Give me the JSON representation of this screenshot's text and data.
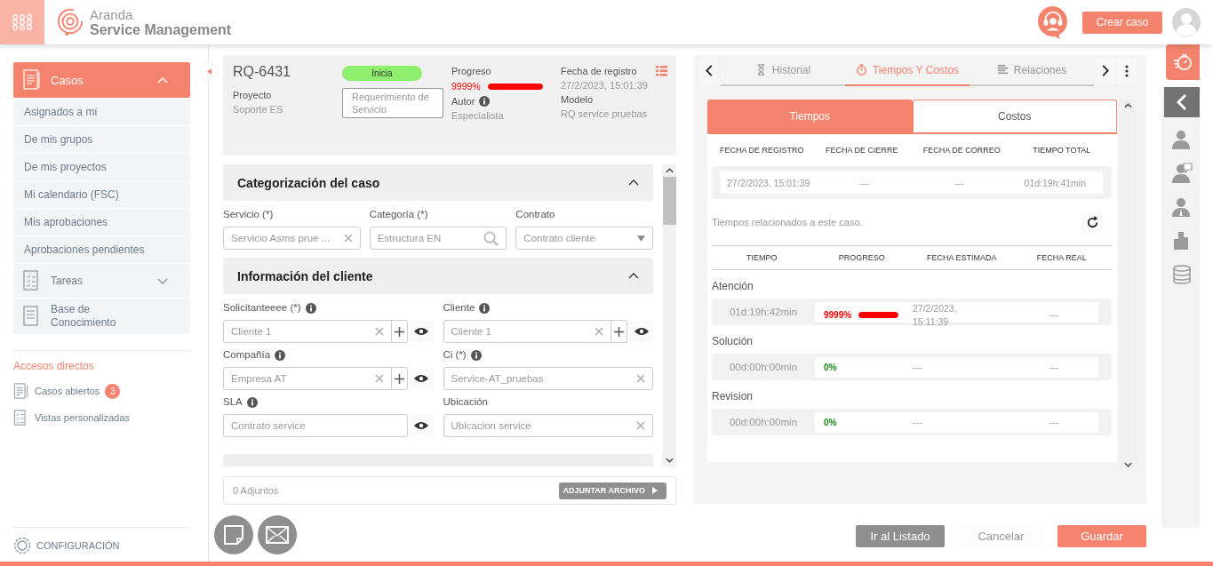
{
  "header": {
    "brand_top": "Aranda",
    "brand_bottom": "Service Management",
    "create_button": "Crear caso"
  },
  "sidebar": {
    "menu": [
      {
        "label": "Casos",
        "kind": "cases",
        "selected": true,
        "expanded": true,
        "children": [
          {
            "label": "Asignados a mi",
            "selected": false
          },
          {
            "label": "De mis grupos",
            "selected": false
          },
          {
            "label": "De mis proyectos",
            "selected": false
          },
          {
            "label": "Mi calendario (FSC)",
            "selected": false
          },
          {
            "label": "Mis aprobaciones",
            "selected": false
          },
          {
            "label": "Aprobaciones pendientes",
            "selected": false
          }
        ]
      },
      {
        "label": "Tareas",
        "kind": "tasks",
        "selected": false,
        "expanded": false
      },
      {
        "label": "Base de Conocimiento",
        "kind": "knowledge",
        "selected": false
      }
    ],
    "shortcuts_title": "Accesos directos",
    "shortcuts": [
      {
        "label": "Casos abiertos",
        "kind": "cases",
        "badge": "3"
      },
      {
        "label": "Vistas personalizadas",
        "kind": "views"
      }
    ],
    "settings": "CONFIGURACIÓN"
  },
  "case": {
    "id": "RQ-6431",
    "status": "Inicia",
    "progress": {
      "label": "Progreso",
      "value": "9999%",
      "level": 1
    },
    "registered": {
      "label": "Fecha de registro",
      "value": "27/2/2023, 15:01:39"
    },
    "project": {
      "label": "Proyecto",
      "value": "Soporte ES"
    },
    "type": "Requerimiento de Servicio",
    "author": {
      "label": "Autor",
      "value": "Especialista",
      "info": true
    },
    "model": {
      "label": "Modelo",
      "value": "RQ service pruebas"
    }
  },
  "sections": [
    {
      "title": "Categorización del caso",
      "expanded": true,
      "fields": [
        {
          "label": "Servicio (*)",
          "value": "Servicio Asms prue ...",
          "kind": "clear"
        },
        {
          "label": "Categoría (*)",
          "value": "Estructura EN",
          "kind": "search"
        },
        {
          "label": "Contrato",
          "value": "Contrato cliente",
          "kind": "select"
        }
      ]
    },
    {
      "title": "Información del cliente",
      "expanded": true,
      "fields": [
        {
          "label": "Solicitanteeee (*)",
          "info": true,
          "value": "Cliente 1",
          "kind": "clear",
          "add": true,
          "view": true
        },
        {
          "label": "Cliente",
          "info": true,
          "value": "Cliente 1",
          "kind": "clear",
          "add": true,
          "view": true
        },
        {
          "label": "Compañía",
          "info": true,
          "value": "Empresa AT",
          "kind": "clear",
          "add": true,
          "view": true
        },
        {
          "label": "Ci (*)",
          "info": true,
          "value": "Service-AT_pruebas",
          "kind": "clear"
        },
        {
          "label": "SLA",
          "info": true,
          "value": "Contrato service",
          "kind": "plain",
          "view": true
        },
        {
          "label": "Ubicación",
          "value": "Ubicacion service",
          "kind": "clear"
        }
      ]
    }
  ],
  "attachments": {
    "count": "0 Adjuntos",
    "button": "ADJUNTAR ARCHIVO"
  },
  "detail_tabs": [
    {
      "label": "Historial",
      "kind": "hourglass",
      "selected": false
    },
    {
      "label": "Tiempos Y Costos",
      "kind": "timer",
      "selected": true
    },
    {
      "label": "Relaciones",
      "kind": "relations",
      "selected": false
    }
  ],
  "sub_tabs": [
    {
      "label": "Tiempos",
      "selected": true
    },
    {
      "label": "Costos",
      "selected": false
    }
  ],
  "summary": {
    "columns": [
      "FECHA DE REGISTRO",
      "FECHA DE CIERRE",
      "FECHA DE CORREO",
      "TIEMPO TOTAL"
    ],
    "values": [
      "27/2/2023, 15:01:39",
      "---",
      "---",
      "01d:19h:41min"
    ]
  },
  "times": {
    "note": "Tiempos relacionados a este caso.",
    "columns": [
      "TIEMPO",
      "PROGRESO",
      "FECHA ESTIMADA",
      "FECHA REAL"
    ],
    "rows": [
      {
        "name": "Atención",
        "time": "01d:19h:42min",
        "progress": "9999%",
        "level": 1,
        "color": "#ff0000",
        "estimated": "27/2/2023, 15:11:39",
        "real": "---"
      },
      {
        "name": "Solución",
        "time": "00d:00h:00min",
        "progress": "0%",
        "color": "#1a8a1a",
        "estimated": "---",
        "real": "---"
      },
      {
        "name": "Revision",
        "time": "00d:00h:00min",
        "progress": "0%",
        "color": "#1a8a1a",
        "estimated": "---",
        "real": "---"
      }
    ]
  },
  "footer_buttons": [
    {
      "label": "Ir al Listado",
      "kind": "secondary"
    },
    {
      "label": "Cancelar",
      "kind": "plain"
    },
    {
      "label": "Guardar",
      "kind": "primary"
    }
  ],
  "rail": [
    {
      "kind": "timer",
      "selected": true
    },
    {
      "kind": "collapse",
      "selected": false
    },
    {
      "kind": "user",
      "selected": false
    },
    {
      "kind": "chat-user",
      "selected": false
    },
    {
      "kind": "agent",
      "selected": false
    },
    {
      "kind": "building",
      "selected": false
    },
    {
      "kind": "database",
      "selected": false
    }
  ]
}
